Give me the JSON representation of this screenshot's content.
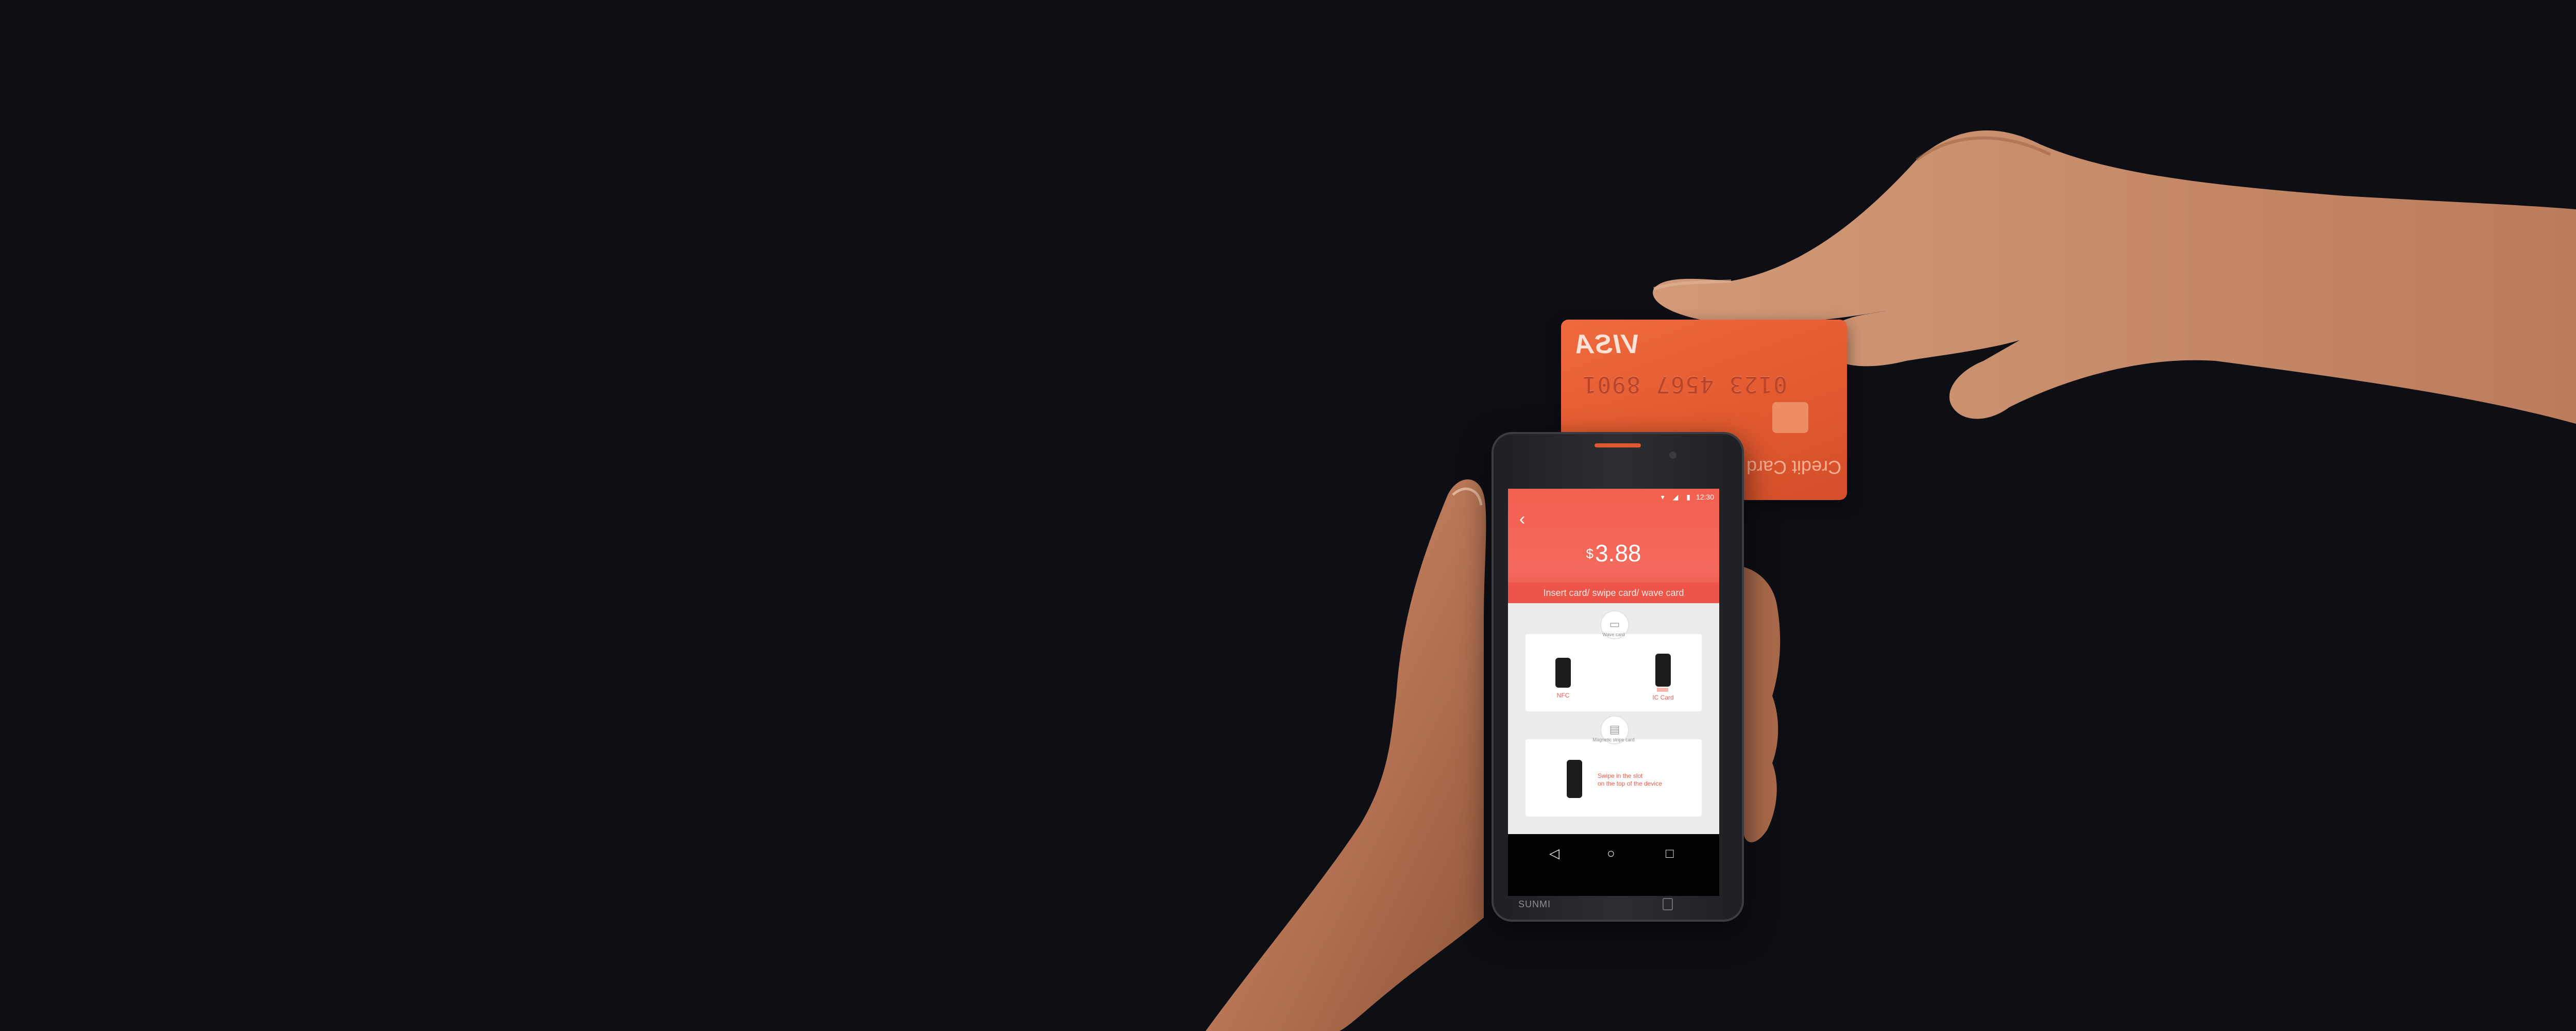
{
  "colors": {
    "background": "#0d0f15",
    "card_orange": "#e35a30",
    "header_red": "#f3604f",
    "accent": "#ef5b4c"
  },
  "card": {
    "brand": "VISA",
    "number": "0123 4567 8901",
    "type_label": "Credit Card"
  },
  "phone": {
    "device_brand": "SUNMI",
    "status": {
      "icons": "▾ ◢ ▮",
      "time": "12:30"
    },
    "screen": {
      "back_icon": "chevron-left-icon",
      "currency": "$",
      "amount": "3.88",
      "prompt": "Insert card/ swipe card/ wave card",
      "section1_label": "Wave card",
      "nfc_label": "NFC",
      "ic_label": "IC Card",
      "section2_label": "Magnetic stripe card",
      "swipe_text_line1": "Swipe in the slot",
      "swipe_text_line2": "on the top of the device"
    },
    "nav": {
      "back": "◁",
      "home": "○",
      "recent": "□"
    }
  }
}
